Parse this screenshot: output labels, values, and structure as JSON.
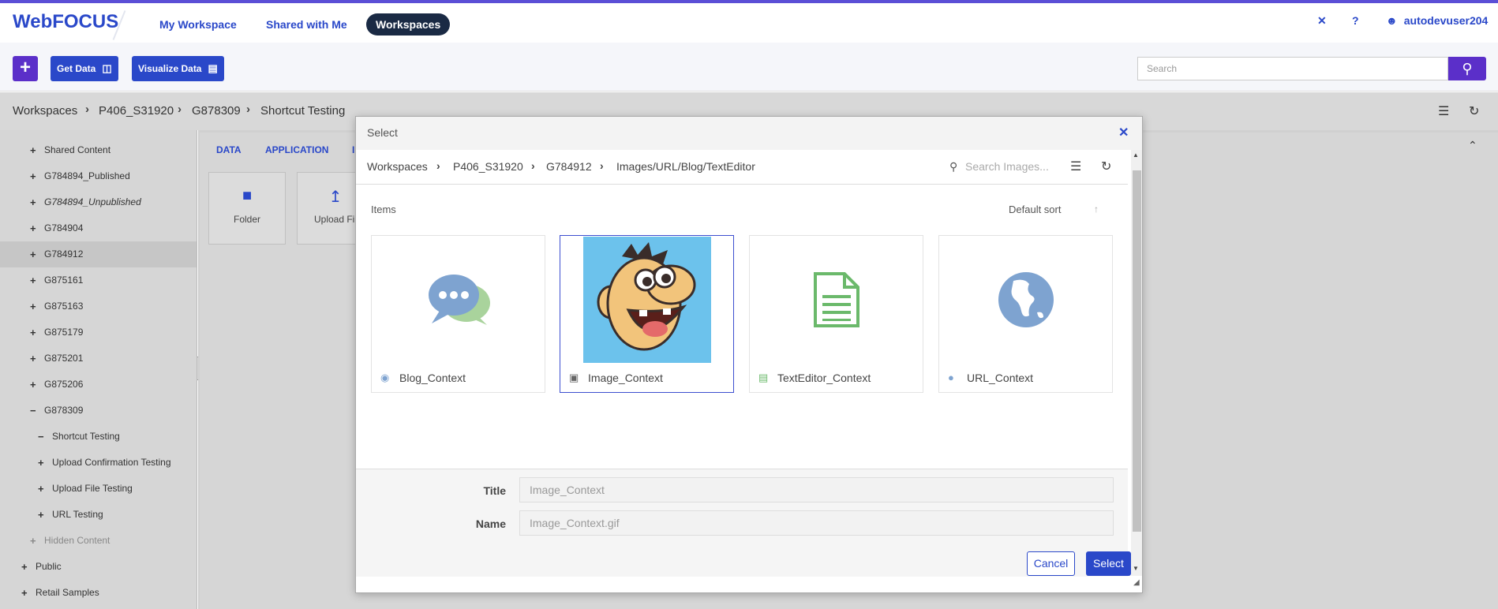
{
  "header": {
    "brand": "WebFOCUS",
    "nav": [
      "My Workspace",
      "Shared with Me",
      "Workspaces"
    ],
    "active_nav": "Workspaces",
    "user": "autodevuser204"
  },
  "toolbar": {
    "get_data": "Get Data",
    "visualize_data": "Visualize Data",
    "search_placeholder": "Search"
  },
  "breadcrumb": [
    "Workspaces",
    "P406_S31920",
    "G878309",
    "Shortcut Testing"
  ],
  "tree": [
    {
      "sign": "+",
      "label": "Shared Content"
    },
    {
      "sign": "+",
      "label": "G784894_Published"
    },
    {
      "sign": "+",
      "label": "G784894_Unpublished"
    },
    {
      "sign": "+",
      "label": "G784904"
    },
    {
      "sign": "+",
      "label": "G784912"
    },
    {
      "sign": "+",
      "label": "G875161"
    },
    {
      "sign": "+",
      "label": "G875163"
    },
    {
      "sign": "+",
      "label": "G875179"
    },
    {
      "sign": "+",
      "label": "G875201"
    },
    {
      "sign": "+",
      "label": "G875206"
    },
    {
      "sign": "−",
      "label": "G878309"
    },
    {
      "sign": "−",
      "label": "Shortcut Testing"
    },
    {
      "sign": "+",
      "label": "Upload Confirmation Testing"
    },
    {
      "sign": "+",
      "label": "Upload File Testing"
    },
    {
      "sign": "+",
      "label": "URL Testing"
    },
    {
      "sign": "+",
      "label": "Hidden Content"
    },
    {
      "sign": "+",
      "label": "Public"
    },
    {
      "sign": "+",
      "label": "Retail Samples"
    }
  ],
  "content_tabs": [
    "DATA",
    "APPLICATION",
    "I"
  ],
  "tiles": [
    "Folder",
    "Upload Fil"
  ],
  "modal": {
    "title": "Select",
    "crumbs": [
      "Workspaces",
      "P406_S31920",
      "G784912",
      "Images/URL/Blog/TextEditor"
    ],
    "search_placeholder": "Search Images...",
    "items_label": "Items",
    "sort_label": "Default sort",
    "cards": [
      {
        "label": "Blog_Context",
        "type": "blog"
      },
      {
        "label": "Image_Context",
        "type": "image"
      },
      {
        "label": "TextEditor_Context",
        "type": "text"
      },
      {
        "label": "URL_Context",
        "type": "url"
      }
    ],
    "title_field_label": "Title",
    "title_field_value": "Image_Context",
    "name_field_label": "Name",
    "name_field_value": "Image_Context.gif",
    "cancel": "Cancel",
    "select": "Select"
  },
  "colors": {
    "brand_blue": "#2a48c9",
    "accent_purple": "#5b2fc9",
    "dark_nav": "#1a2a44"
  }
}
